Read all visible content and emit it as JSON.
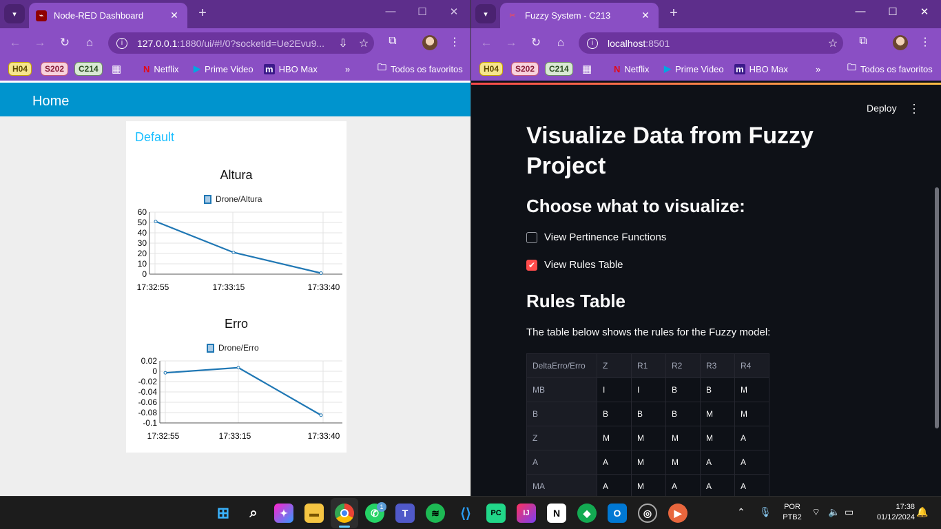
{
  "left_window": {
    "tab_title": "Node-RED Dashboard",
    "url_host": "127.0.0.1",
    "url_rest": ":1880/ui/#!/0?socketid=Ue2Evu9...",
    "dashboard": {
      "header_title": "Home",
      "group_title": "Default",
      "charts": [
        {
          "title": "Altura",
          "legend": "Drone/Altura"
        },
        {
          "title": "Erro",
          "legend": "Drone/Erro"
        }
      ]
    }
  },
  "right_window": {
    "tab_title": "Fuzzy System - C213",
    "url_host": "localhost",
    "url_rest": ":8501",
    "app": {
      "deploy_label": "Deploy",
      "title": "Visualize Data from Fuzzy Project",
      "subheader": "Choose what to visualize:",
      "checkboxes": [
        {
          "label": "View Pertinence Functions",
          "checked": false
        },
        {
          "label": "View Rules Table",
          "checked": true
        }
      ],
      "table_heading": "Rules Table",
      "table_caption": "The table below shows the rules for the Fuzzy model:",
      "table": {
        "columns": [
          "DeltaErro/Erro",
          "Z",
          "R1",
          "R2",
          "R3",
          "R4"
        ],
        "rows": [
          [
            "MB",
            "I",
            "I",
            "B",
            "B",
            "M"
          ],
          [
            "B",
            "B",
            "B",
            "B",
            "M",
            "M"
          ],
          [
            "Z",
            "M",
            "M",
            "M",
            "M",
            "A"
          ],
          [
            "A",
            "A",
            "M",
            "M",
            "A",
            "A"
          ],
          [
            "MA",
            "A",
            "M",
            "A",
            "A",
            "A"
          ]
        ]
      }
    }
  },
  "bookmarks": {
    "chips": [
      "H04",
      "S202",
      "C214"
    ],
    "netflix": "Netflix",
    "prime": "Prime Video",
    "hbo": "HBO Max",
    "overflow": "»",
    "all": "Todos os favoritos"
  },
  "chart_data": [
    {
      "type": "line",
      "title": "Altura",
      "series": [
        {
          "name": "Drone/Altura",
          "x": [
            "17:32:55",
            "17:33:15",
            "17:33:40"
          ],
          "values": [
            51,
            21,
            1
          ]
        }
      ],
      "x_ticks": [
        "17:32:55",
        "17:33:15",
        "17:33:40"
      ],
      "y_ticks": [
        "60",
        "50",
        "40",
        "30",
        "20",
        "10",
        "0"
      ],
      "ylim": [
        0,
        60
      ],
      "grid": true,
      "legend_position": "top"
    },
    {
      "type": "line",
      "title": "Erro",
      "series": [
        {
          "name": "Drone/Erro",
          "x": [
            "17:32:55",
            "17:33:15",
            "17:33:40"
          ],
          "values": [
            -0.003,
            0.007,
            -0.085
          ]
        }
      ],
      "x_ticks": [
        "17:32:55",
        "17:33:15",
        "17:33:40"
      ],
      "y_ticks": [
        "0.02",
        "0",
        "-0.02",
        "-0.04",
        "-0.06",
        "-0.08",
        "-0.1"
      ],
      "ylim": [
        -0.1,
        0.02
      ],
      "grid": true,
      "legend_position": "top"
    }
  ],
  "taskbar": {
    "whatsapp_badge": "1",
    "lang_top": "POR",
    "lang_bottom": "PTB2",
    "time": "17:38",
    "date": "01/12/2024"
  },
  "colors": {
    "chrome_purple": "#8a4fc4",
    "nodered_header": "#0094ce",
    "series_line": "#1f77b4",
    "streamlit_accent": "#ff4b4b",
    "streamlit_bg": "#0e1117"
  }
}
